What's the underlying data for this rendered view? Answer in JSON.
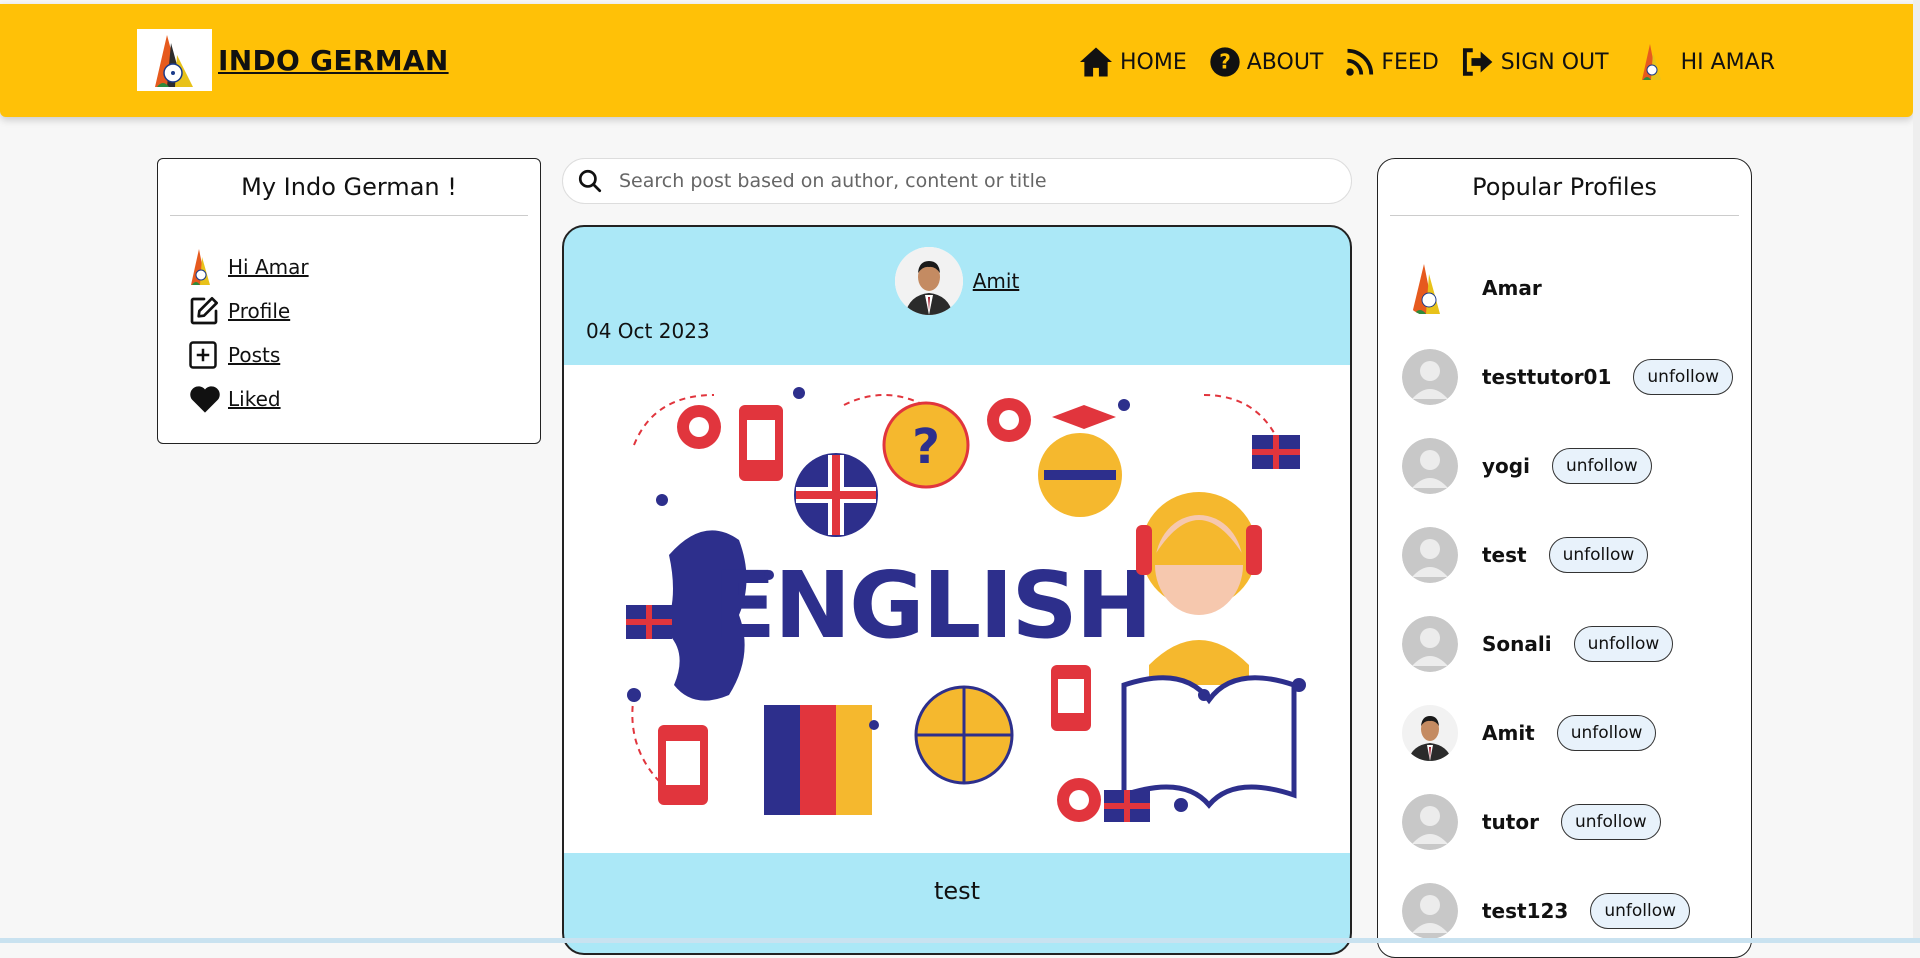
{
  "colors": {
    "header": "#ffc107",
    "post_bg": "#abe8f7",
    "button_bg": "#e8f2fb"
  },
  "header": {
    "brand": "INDO GERMAN",
    "nav": [
      {
        "label": "HOME",
        "icon": "home-icon"
      },
      {
        "label": "ABOUT",
        "icon": "question-icon"
      },
      {
        "label": "FEED",
        "icon": "rss-icon"
      },
      {
        "label": "SIGN OUT",
        "icon": "sign-out-icon"
      }
    ],
    "user_greeting": "HI AMAR"
  },
  "left_panel": {
    "title": "My Indo German !",
    "items": [
      {
        "label": " Hi Amar",
        "icon": "logo-icon"
      },
      {
        "label": "Profile",
        "icon": "edit-icon"
      },
      {
        "label": "Posts",
        "icon": "plus-square-icon"
      },
      {
        "label": "Liked",
        "icon": "heart-icon"
      }
    ]
  },
  "search": {
    "placeholder": "Search post based on author, content or title"
  },
  "post": {
    "author": "Amit",
    "date": "04 Oct 2023",
    "image_text": "ENGLISH",
    "title": "test"
  },
  "right_panel": {
    "title": "Popular Profiles",
    "profiles": [
      {
        "name": "Amar",
        "avatar": "logo",
        "button": ""
      },
      {
        "name": "testtutor01",
        "avatar": "default",
        "button": "unfollow"
      },
      {
        "name": "yogi",
        "avatar": "default",
        "button": "unfollow"
      },
      {
        "name": "test",
        "avatar": "default",
        "button": "unfollow"
      },
      {
        "name": "Sonali",
        "avatar": "default",
        "button": "unfollow"
      },
      {
        "name": "Amit",
        "avatar": "photo",
        "button": "unfollow"
      },
      {
        "name": "tutor",
        "avatar": "default",
        "button": "unfollow"
      },
      {
        "name": "test123",
        "avatar": "default",
        "button": "unfollow"
      }
    ]
  }
}
